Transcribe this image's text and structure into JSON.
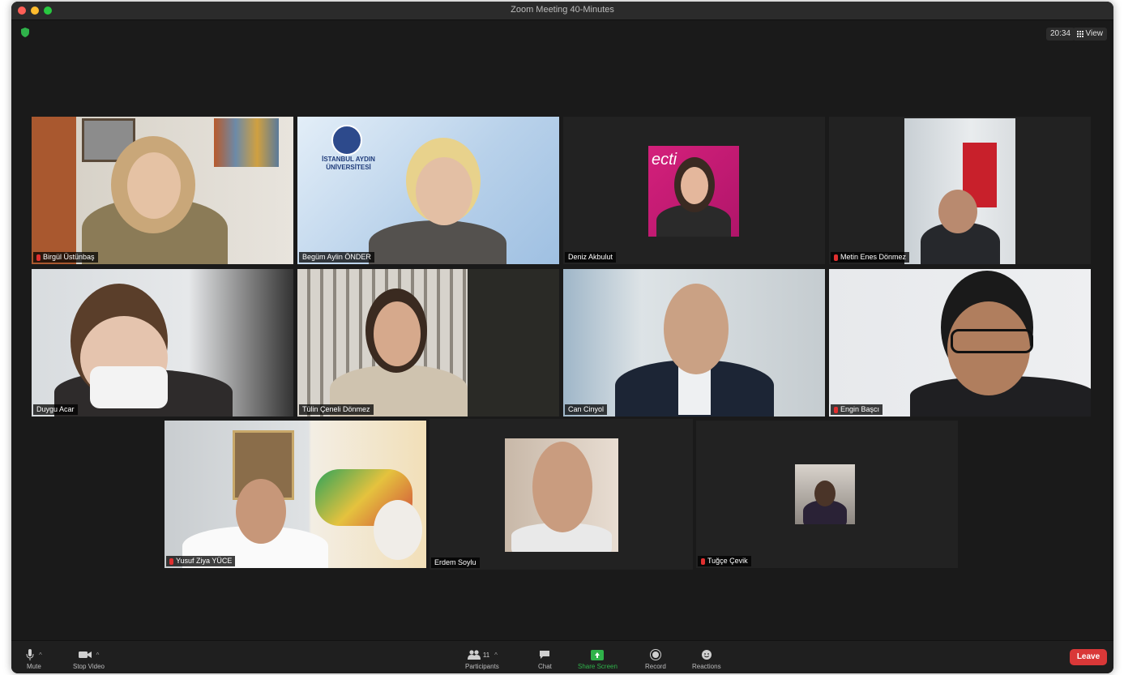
{
  "window": {
    "title": "Zoom Meeting  40-Minutes",
    "clock": "20:34",
    "view_label": "View"
  },
  "participants": [
    {
      "name": "Birgül Üstünbaş",
      "muted": true
    },
    {
      "name": "Begüm Aylin ÖNDER",
      "muted": false
    },
    {
      "name": "Deniz Akbulut",
      "muted": false
    },
    {
      "name": "Metin Enes Dönmez",
      "muted": true
    },
    {
      "name": "Duygu Acar",
      "muted": false
    },
    {
      "name": "Tülin Çeneli Dönmez",
      "muted": false
    },
    {
      "name": "Can Cinyol",
      "muted": false
    },
    {
      "name": "Engin Başcı",
      "muted": true
    },
    {
      "name": "Yusuf Ziya YÜCE",
      "muted": true
    },
    {
      "name": "Erdem Soylu",
      "muted": false,
      "active_speaker": true
    },
    {
      "name": "Tuğçe Çevik",
      "muted": true
    }
  ],
  "logo": {
    "line1": "İSTANBUL AYDIN",
    "line2": "ÜNİVERSİTESİ"
  },
  "banner_text": "ecti",
  "toolbar": {
    "mute_label": "Mute",
    "video_label": "Stop Video",
    "participants_label": "Participants",
    "participants_count": "11",
    "chat_label": "Chat",
    "share_label": "Share Screen",
    "record_label": "Record",
    "reactions_label": "Reactions",
    "leave_label": "Leave"
  },
  "colors": {
    "share_green": "#2fb24a",
    "leave_red": "#d93838",
    "active_outline": "#c9d77a",
    "muted_red": "#e02f2f"
  }
}
